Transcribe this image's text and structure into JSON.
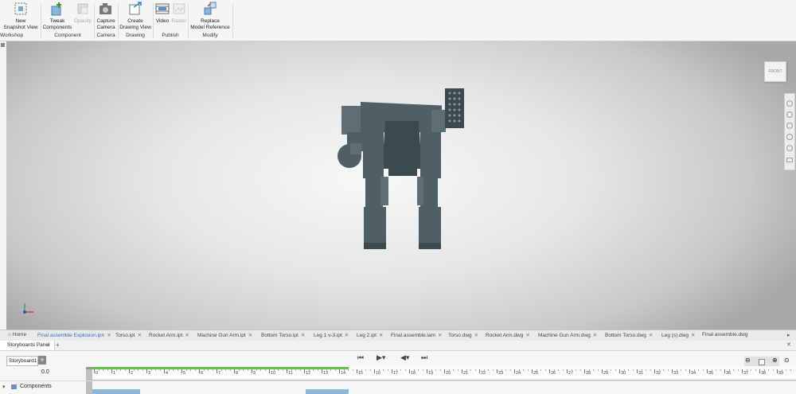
{
  "ribbon": {
    "buttons": {
      "new_snapshot": [
        "New",
        "Snapshot View"
      ],
      "tweak": [
        "Tweak",
        "Components"
      ],
      "opacity": "Opacity",
      "capture": [
        "Capture",
        "Camera"
      ],
      "create_drawing": [
        "Create",
        "Drawing View"
      ],
      "video": "Video",
      "raster": "Raster",
      "replace": [
        "Replace",
        "Model Reference"
      ]
    },
    "groups": {
      "workshop": "Workshop",
      "component": "Component",
      "camera": "Camera",
      "drawing": "Drawing",
      "publish": "Publish",
      "modify": "Modify"
    }
  },
  "viewcube": {
    "label": "FRONT"
  },
  "tabs": {
    "home": "Home",
    "items": [
      "Final assemble Explosion.ipn",
      "Torso.ipt",
      "Rocket Arm.ipt",
      "Machine Gun Arm.ipt",
      "Bottom Torso.ipt",
      "Leg 1 v-3.ipt",
      "Leg 2.ipt",
      "Final assemble.iam",
      "Torso.dwg",
      "Rocket Arm.dwg",
      "Machine Gun Arm.dwg",
      "Bottom Torso.dwg",
      "Leg (s).dwg",
      "Final assemble.dwg"
    ],
    "close_glyph": "✕"
  },
  "storyboard": {
    "panel_title": "Storyboards Panel",
    "storyboard_tab": "Storyboard1",
    "time_value": "0.0",
    "components_label": "Components",
    "ruler_ticks": [
      "0",
      "1",
      "2",
      "3",
      "4",
      "5",
      "6",
      "7",
      "8",
      "9",
      "10",
      "11",
      "12",
      "13",
      "14",
      "15",
      "16",
      "17",
      "18",
      "19",
      "20",
      "21",
      "22",
      "23",
      "24",
      "25",
      "26",
      "27",
      "28",
      "29",
      "30",
      "31",
      "32",
      "33",
      "34",
      "35",
      "36",
      "37",
      "38",
      "39",
      "40"
    ]
  },
  "colors": {
    "accent": "#2a6fb0",
    "model": "#4f5f66",
    "timeline_green": "#6cbf4a"
  }
}
